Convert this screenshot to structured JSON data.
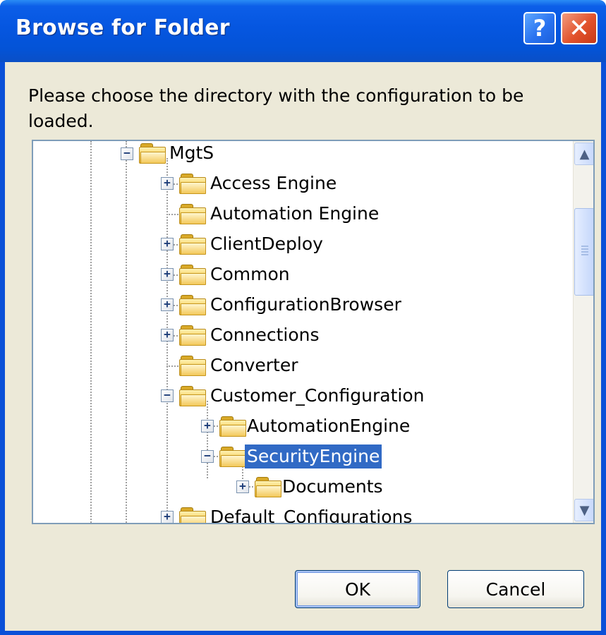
{
  "window": {
    "title": "Browse for Folder",
    "help_button": "?",
    "close_button": "✕"
  },
  "dialog": {
    "prompt": "Please choose the directory with the configuration to be loaded."
  },
  "tree": {
    "selected": "SecurityEngine",
    "nodes": [
      {
        "label": "MgtS",
        "level": 0,
        "expander": "minus",
        "icon": "folder-icon"
      },
      {
        "label": "Access Engine",
        "level": 1,
        "expander": "plus",
        "icon": "folder-icon"
      },
      {
        "label": "Automation Engine",
        "level": 1,
        "expander": "none",
        "icon": "folder-icon"
      },
      {
        "label": "ClientDeploy",
        "level": 1,
        "expander": "plus",
        "icon": "folder-icon"
      },
      {
        "label": "Common",
        "level": 1,
        "expander": "plus",
        "icon": "folder-icon"
      },
      {
        "label": "ConfigurationBrowser",
        "level": 1,
        "expander": "plus",
        "icon": "folder-icon"
      },
      {
        "label": "Connections",
        "level": 1,
        "expander": "plus",
        "icon": "folder-icon"
      },
      {
        "label": "Converter",
        "level": 1,
        "expander": "none",
        "icon": "folder-icon"
      },
      {
        "label": "Customer_Configuration",
        "level": 1,
        "expander": "minus",
        "icon": "folder-icon"
      },
      {
        "label": "AutomationEngine",
        "level": 2,
        "expander": "plus",
        "icon": "folder-icon"
      },
      {
        "label": "SecurityEngine",
        "level": 2,
        "expander": "minus",
        "icon": "folder-open-icon",
        "selected": true
      },
      {
        "label": "Documents",
        "level": 3,
        "expander": "plus",
        "icon": "folder-icon"
      },
      {
        "label": "Default_Configurations",
        "level": 1,
        "expander": "plus",
        "icon": "folder-icon",
        "partially_visible": true
      }
    ]
  },
  "scrollbar": {
    "up_icon": "scroll-up-arrow-icon",
    "down_icon": "scroll-down-arrow-icon",
    "thumb_grip_icon": "grip-icon"
  },
  "buttons": {
    "ok_label": "OK",
    "cancel_label": "Cancel"
  },
  "colors": {
    "titlebar": "#0556e0",
    "client_background": "#ece9d8",
    "selection": "#316ac5",
    "close_button": "#e2522c"
  }
}
